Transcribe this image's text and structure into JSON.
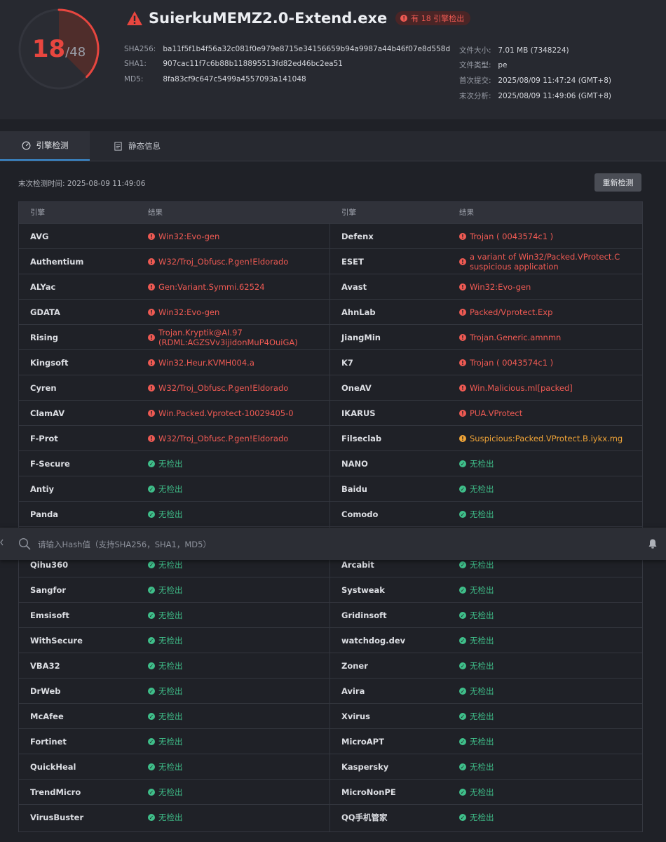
{
  "header": {
    "score": {
      "detected": "18",
      "total": "/48"
    },
    "file_name": "SuierkuMEMZ2.0-Extend.exe",
    "badge": "有 18 引擎检出",
    "hashes": [
      {
        "label": "SHA256:",
        "value": "ba11f5f1b4f56a32c081f0e979e8715e34156659b94a9987a44b46f07e8d558d"
      },
      {
        "label": "SHA1:",
        "value": "907cac11f7c6b88b118895513fd82ed46bc2ea51"
      },
      {
        "label": "MD5:",
        "value": "8fa83cf9c647c5499a4557093a141048"
      }
    ],
    "info": [
      {
        "label": "文件大小:",
        "value": "7.01 MB (7348224)"
      },
      {
        "label": "文件类型:",
        "value": "pe"
      },
      {
        "label": "首次提交:",
        "value": "2025/08/09 11:47:24 (GMT+8)"
      },
      {
        "label": "末次分析:",
        "value": "2025/08/09 11:49:06 (GMT+8)"
      }
    ]
  },
  "tabs": [
    {
      "label": "引擎检测",
      "icon": "gauge-icon",
      "active": true
    },
    {
      "label": "静态信息",
      "icon": "document-icon",
      "active": false
    }
  ],
  "last_check": "末次检测时间: 2025-08-09 11:49:06",
  "recheck_button": "重新检测",
  "table_headers": {
    "engine": "引擎",
    "result": "结果"
  },
  "rows": [
    {
      "l_engine": "AVG",
      "l_result": "Win32:Evo-gen",
      "l_status": "mal",
      "r_engine": "Defenx",
      "r_result": "Trojan ( 0043574c1 )",
      "r_status": "mal"
    },
    {
      "l_engine": "Authentium",
      "l_result": "W32/Troj_Obfusc.P.gen!Eldorado",
      "l_status": "mal",
      "r_engine": "ESET",
      "r_result": "a variant of Win32/Packed.VProtect.C suspicious application",
      "r_status": "mal"
    },
    {
      "l_engine": "ALYac",
      "l_result": "Gen:Variant.Symmi.62524",
      "l_status": "mal",
      "r_engine": "Avast",
      "r_result": "Win32:Evo-gen",
      "r_status": "mal"
    },
    {
      "l_engine": "GDATA",
      "l_result": "Win32:Evo-gen",
      "l_status": "mal",
      "r_engine": "AhnLab",
      "r_result": "Packed/Vprotect.Exp",
      "r_status": "mal"
    },
    {
      "l_engine": "Rising",
      "l_result": "Trojan.Kryptik@AI.97 (RDML:AGZSVv3ijidonMuP4OuiGA)",
      "l_status": "mal",
      "r_engine": "JiangMin",
      "r_result": "Trojan.Generic.amnmn",
      "r_status": "mal"
    },
    {
      "l_engine": "Kingsoft",
      "l_result": "Win32.Heur.KVMH004.a",
      "l_status": "mal",
      "r_engine": "K7",
      "r_result": "Trojan ( 0043574c1 )",
      "r_status": "mal"
    },
    {
      "l_engine": "Cyren",
      "l_result": "W32/Troj_Obfusc.P.gen!Eldorado",
      "l_status": "mal",
      "r_engine": "OneAV",
      "r_result": "Win.Malicious.ml[packed]",
      "r_status": "mal"
    },
    {
      "l_engine": "ClamAV",
      "l_result": "Win.Packed.Vprotect-10029405-0",
      "l_status": "mal",
      "r_engine": "IKARUS",
      "r_result": "PUA.VProtect",
      "r_status": "mal"
    },
    {
      "l_engine": "F-Prot",
      "l_result": "W32/Troj_Obfusc.P.gen!Eldorado",
      "l_status": "mal",
      "r_engine": "Filseclab",
      "r_result": "Suspicious:Packed.VProtect.B.iykx.mg",
      "r_status": "sus"
    },
    {
      "l_engine": "F-Secure",
      "l_result": "无检出",
      "l_status": "clean",
      "r_engine": "NANO",
      "r_result": "无检出",
      "r_status": "clean"
    },
    {
      "l_engine": "Antiy",
      "l_result": "无检出",
      "l_status": "clean",
      "r_engine": "Baidu",
      "r_result": "无检出",
      "r_status": "clean"
    },
    {
      "l_engine": "Panda",
      "l_result": "无检出",
      "l_status": "clean",
      "r_engine": "Comodo",
      "r_result": "无检出",
      "r_status": "clean"
    },
    {
      "l_engine": "",
      "l_result": "",
      "l_status": "",
      "r_engine": "",
      "r_result": "",
      "r_status": ""
    },
    {
      "l_engine": "Qihu360",
      "l_result": "无检出",
      "l_status": "clean",
      "r_engine": "Arcabit",
      "r_result": "无检出",
      "r_status": "clean"
    },
    {
      "l_engine": "Sangfor",
      "l_result": "无检出",
      "l_status": "clean",
      "r_engine": "Systweak",
      "r_result": "无检出",
      "r_status": "clean"
    },
    {
      "l_engine": "Emsisoft",
      "l_result": "无检出",
      "l_status": "clean",
      "r_engine": "Gridinsoft",
      "r_result": "无检出",
      "r_status": "clean"
    },
    {
      "l_engine": "WithSecure",
      "l_result": "无检出",
      "l_status": "clean",
      "r_engine": "watchdog.dev",
      "r_result": "无检出",
      "r_status": "clean"
    },
    {
      "l_engine": "VBA32",
      "l_result": "无检出",
      "l_status": "clean",
      "r_engine": "Zoner",
      "r_result": "无检出",
      "r_status": "clean"
    },
    {
      "l_engine": "DrWeb",
      "l_result": "无检出",
      "l_status": "clean",
      "r_engine": "Avira",
      "r_result": "无检出",
      "r_status": "clean"
    },
    {
      "l_engine": "McAfee",
      "l_result": "无检出",
      "l_status": "clean",
      "r_engine": "Xvirus",
      "r_result": "无检出",
      "r_status": "clean"
    },
    {
      "l_engine": "Fortinet",
      "l_result": "无检出",
      "l_status": "clean",
      "r_engine": "MicroAPT",
      "r_result": "无检出",
      "r_status": "clean"
    },
    {
      "l_engine": "QuickHeal",
      "l_result": "无检出",
      "l_status": "clean",
      "r_engine": "Kaspersky",
      "r_result": "无检出",
      "r_status": "clean"
    },
    {
      "l_engine": "TrendMicro",
      "l_result": "无检出",
      "l_status": "clean",
      "r_engine": "MicroNonPE",
      "r_result": "无检出",
      "r_status": "clean"
    },
    {
      "l_engine": "VirusBuster",
      "l_result": "无检出",
      "l_status": "clean",
      "r_engine": "QQ手机管家",
      "r_result": "无检出",
      "r_status": "clean"
    }
  ],
  "search": {
    "placeholder": "请输入Hash值（支持SHA256，SHA1，MD5）"
  },
  "colors": {
    "malicious": "#ef5a53",
    "suspicious": "#f0a437",
    "clean": "#3fbf8a",
    "accent": "#3b8fd6",
    "background": "#1f2127"
  }
}
